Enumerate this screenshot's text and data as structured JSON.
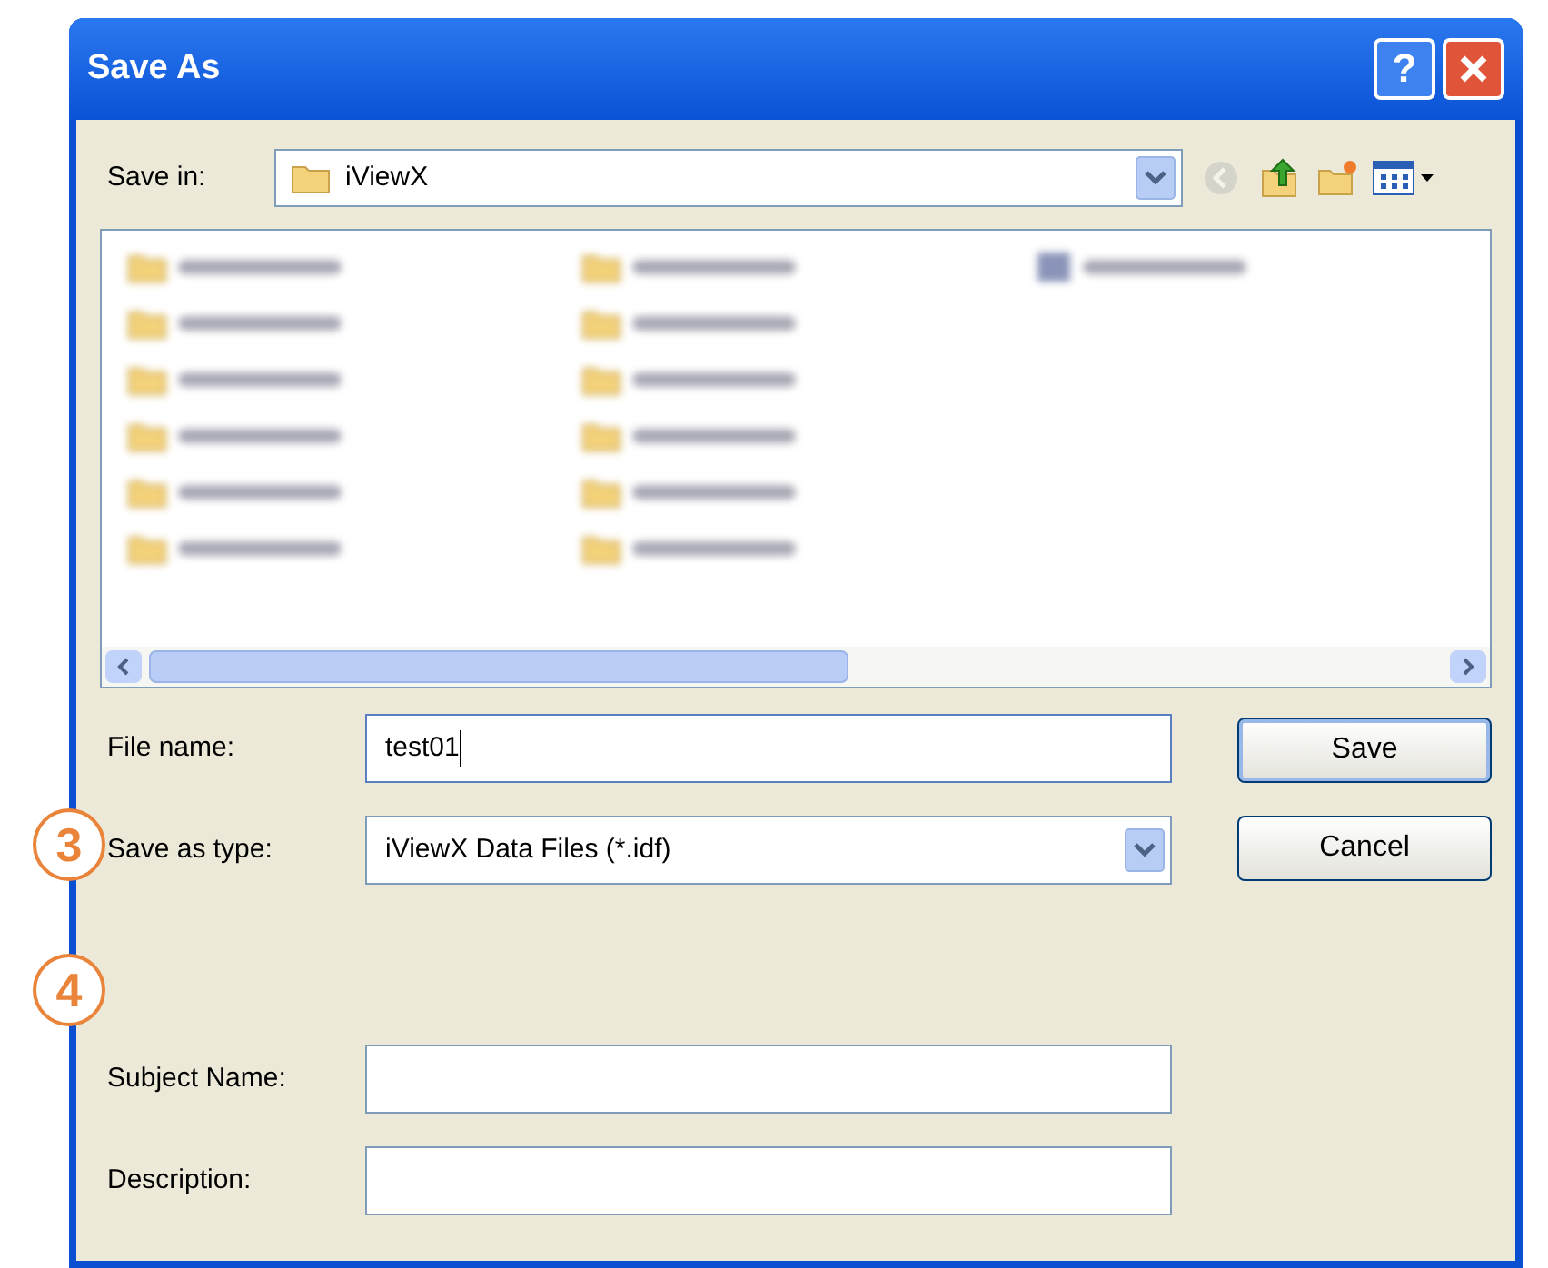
{
  "window": {
    "title": "Save As"
  },
  "title_buttons": [
    {
      "kind": "help",
      "label": "?"
    },
    {
      "kind": "close"
    }
  ],
  "save_in": {
    "label": "Save in:",
    "value": "iViewX"
  },
  "toolbar": [
    {
      "kind": "back",
      "disabled": true
    },
    {
      "kind": "up",
      "disabled": false
    },
    {
      "kind": "new_folder",
      "disabled": false
    },
    {
      "kind": "views",
      "disabled": false
    }
  ],
  "file_list": {
    "columns": [
      [
        {
          "kind": "folder"
        },
        {
          "kind": "folder"
        },
        {
          "kind": "folder"
        },
        {
          "kind": "folder"
        },
        {
          "kind": "folder"
        },
        {
          "kind": "folder"
        }
      ],
      [
        {
          "kind": "folder"
        },
        {
          "kind": "folder"
        },
        {
          "kind": "folder"
        },
        {
          "kind": "folder"
        },
        {
          "kind": "folder"
        },
        {
          "kind": "folder"
        }
      ],
      [
        {
          "kind": "file"
        }
      ]
    ]
  },
  "fields": [
    {
      "kind": "text",
      "label": "File name:",
      "value": "test01",
      "focused": true
    },
    {
      "kind": "combo",
      "label": "Save as type:",
      "value": "iViewX Data Files (*.idf)",
      "focused": false
    },
    {
      "kind": "spacer"
    },
    {
      "kind": "text",
      "label": "Subject Name:",
      "focused": false
    },
    {
      "kind": "text",
      "label": "Description:",
      "focused": false
    }
  ],
  "buttons": [
    {
      "label": "Save",
      "default": true
    },
    {
      "label": "Cancel",
      "default": false
    }
  ],
  "callouts": [
    "3",
    "4"
  ]
}
